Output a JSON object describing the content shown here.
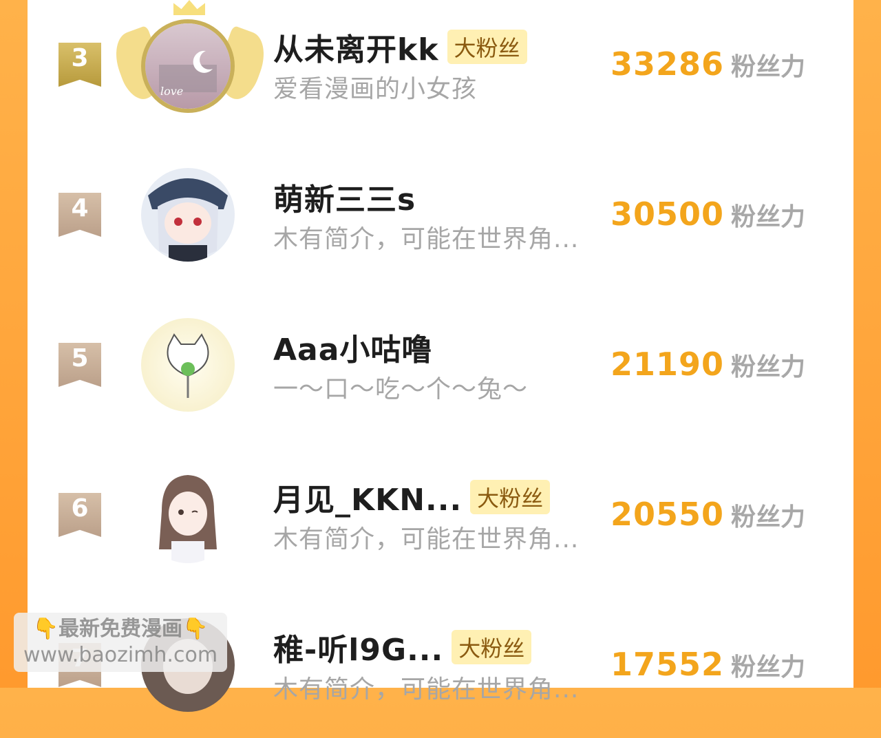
{
  "rows": [
    {
      "rank": "3",
      "name": "从未离开kk",
      "badge": "大粉丝",
      "bio": "爱看漫画的小女孩",
      "score": "33286",
      "unit": "粉丝力"
    },
    {
      "rank": "4",
      "name": "萌新三三s",
      "badge": "",
      "bio": "木有简介，可能在世界角...",
      "score": "30500",
      "unit": "粉丝力"
    },
    {
      "rank": "5",
      "name": "Aaa小咕噜",
      "badge": "",
      "bio": "一～口～吃～个～兔～",
      "score": "21190",
      "unit": "粉丝力"
    },
    {
      "rank": "6",
      "name": "月见_KKN...",
      "badge": "大粉丝",
      "bio": "木有简介，可能在世界角...",
      "score": "20550",
      "unit": "粉丝力"
    },
    {
      "rank": "7",
      "name": "稚-听l9G...",
      "badge": "大粉丝",
      "bio": "木有简介，可能在世界角...",
      "score": "17552",
      "unit": "粉丝力"
    }
  ],
  "watermark": {
    "line1": "最新免费漫画",
    "line2": "www.baozimh.com",
    "hand_icon": "pointing-down-hand-icon"
  },
  "colors": {
    "accent": "#f3a51c",
    "side_background": "#ff9a2e",
    "badge_background": "#fff0b3"
  }
}
